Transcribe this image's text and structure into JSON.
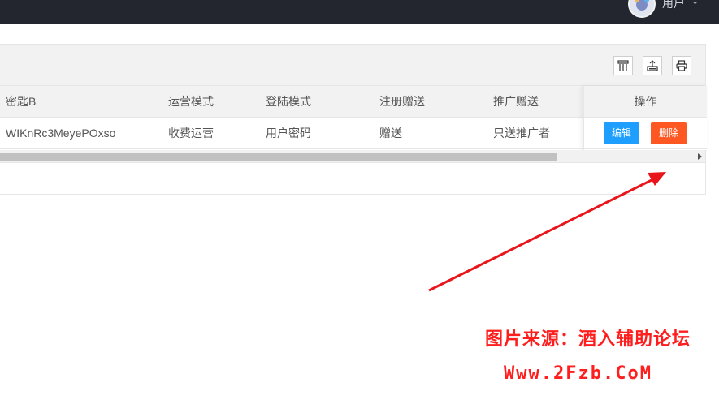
{
  "topbar": {
    "user_name": "用户",
    "caret": "⌄"
  },
  "toolbar": {
    "icons": [
      "columns-icon",
      "export-icon",
      "print-icon"
    ]
  },
  "table": {
    "headers": [
      "密匙B",
      "运营模式",
      "登陆模式",
      "注册赠送",
      "推广赠送"
    ],
    "action_header": "操作",
    "rows": [
      {
        "cells": [
          "WIKnRc3MeyePOxso",
          "收费运营",
          "用户密码",
          "赠送",
          "只送推广者"
        ],
        "edit_label": "编辑",
        "delete_label": "删除"
      }
    ]
  },
  "colors": {
    "topbar": "#23262e",
    "edit_button": "#1e9fff",
    "delete_button": "#ff5722",
    "annotation_arrow": "#e8161b"
  },
  "watermark": {
    "line1": "图片来源：酒入辅助论坛",
    "line2": "Www.2Fzb.CoM"
  }
}
